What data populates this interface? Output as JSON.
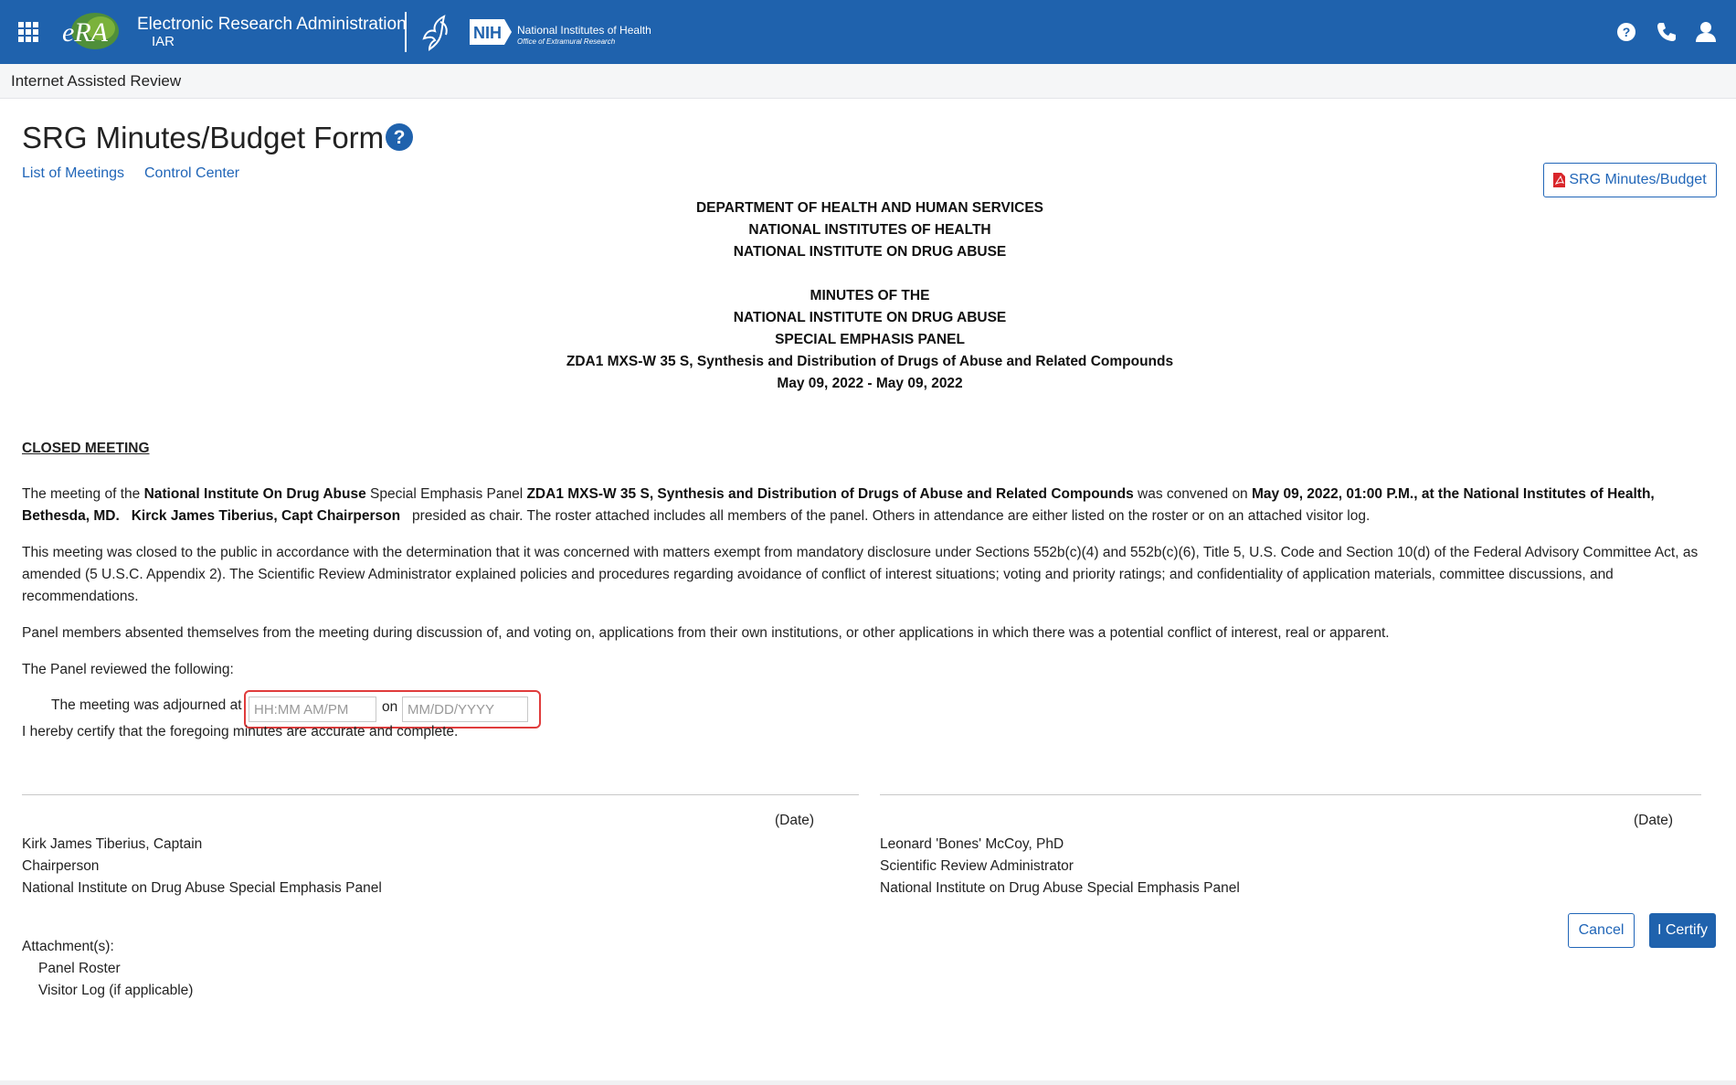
{
  "header": {
    "app_name": "Electronic Research Administration",
    "app_module": "IAR",
    "logo_text": "eRA",
    "nih_badge": "NIH",
    "nih_name": "National Institutes of Health",
    "nih_office": "Office of Extramural Research",
    "icons": [
      "apps-grid-icon",
      "help-icon",
      "phone-icon",
      "user-icon"
    ]
  },
  "subheader": {
    "title": "Internet Assisted Review"
  },
  "page": {
    "title": "SRG Minutes/Budget Form",
    "links": {
      "meetings": "List of Meetings",
      "control_center": "Control Center"
    },
    "pdf_button": "SRG Minutes/Budget"
  },
  "doc": {
    "agency_lines": [
      "DEPARTMENT OF HEALTH AND HUMAN SERVICES",
      "NATIONAL INSTITUTES OF HEALTH",
      "NATIONAL INSTITUTE ON DRUG ABUSE"
    ],
    "minutes_lines": [
      "MINUTES OF THE",
      "NATIONAL INSTITUTE ON DRUG ABUSE",
      "SPECIAL EMPHASIS PANEL",
      "ZDA1 MXS-W 35 S, Synthesis and Distribution of Drugs of Abuse and Related Compounds",
      "May 09, 2022 - May 09, 2022"
    ],
    "section_title": "CLOSED MEETING",
    "p1": {
      "t1": "The meeting of the ",
      "b1": "National Institute On Drug Abuse",
      "t2": " Special Emphasis Panel ",
      "b2": "ZDA1 MXS-W 35 S, Synthesis and Distribution of Drugs of Abuse and Related Compounds",
      "t3": " was convened on ",
      "b3": "May 09, 2022, 01:00 P.M., at the National Institutes of Health, Bethesda, MD.",
      "b4": "Kirck James Tiberius, Capt Chairperson",
      "t4": "   presided as chair. The roster attached includes all members of the panel. Others in attendance are either listed on the roster or on an attached visitor log."
    },
    "p2": "This meeting was closed to the public in accordance with the determination that it was concerned with matters exempt from mandatory disclosure under Sections 552b(c)(4) and 552b(c)(6), Title 5, U.S. Code and Section 10(d) of the Federal Advisory Committee Act, as amended (5 U.S.C. Appendix 2). The Scientific Review Administrator explained policies and procedures regarding avoidance of conflict of interest situations; voting and priority ratings; and confidentiality of application materials, committee discussions, and recommendations.",
    "p3": "Panel members absented themselves from the meeting during discussion of, and voting on, applications from their own institutions, or other applications in which there was a potential conflict of interest, real or apparent.",
    "p4": "The Panel reviewed the following:",
    "adjourn_label": "The meeting was adjourned at",
    "time_placeholder": "HH:MM AM/PM",
    "on_label": "on",
    "date_placeholder": "MM/DD/YYYY",
    "certify_text": "I hereby certify that the foregoing minutes are accurate and complete."
  },
  "signatures": [
    {
      "date_label": "(Date)",
      "name": "Kirk James Tiberius, Captain",
      "role": "Chairperson",
      "org": "National Institute on Drug Abuse Special Emphasis Panel"
    },
    {
      "date_label": "(Date)",
      "name": "Leonard 'Bones' McCoy, PhD",
      "role": "Scientific Review Administrator",
      "org": "National Institute on Drug Abuse Special Emphasis Panel"
    }
  ],
  "attachments": {
    "label": "Attachment(s):",
    "items": [
      "Panel Roster",
      "Visitor Log (if applicable)"
    ]
  },
  "actions": {
    "cancel": "Cancel",
    "certify": "I Certify"
  },
  "colors": {
    "header_bg": "#1f62ad",
    "link": "#2166b8",
    "highlight": "#e03c3c"
  }
}
